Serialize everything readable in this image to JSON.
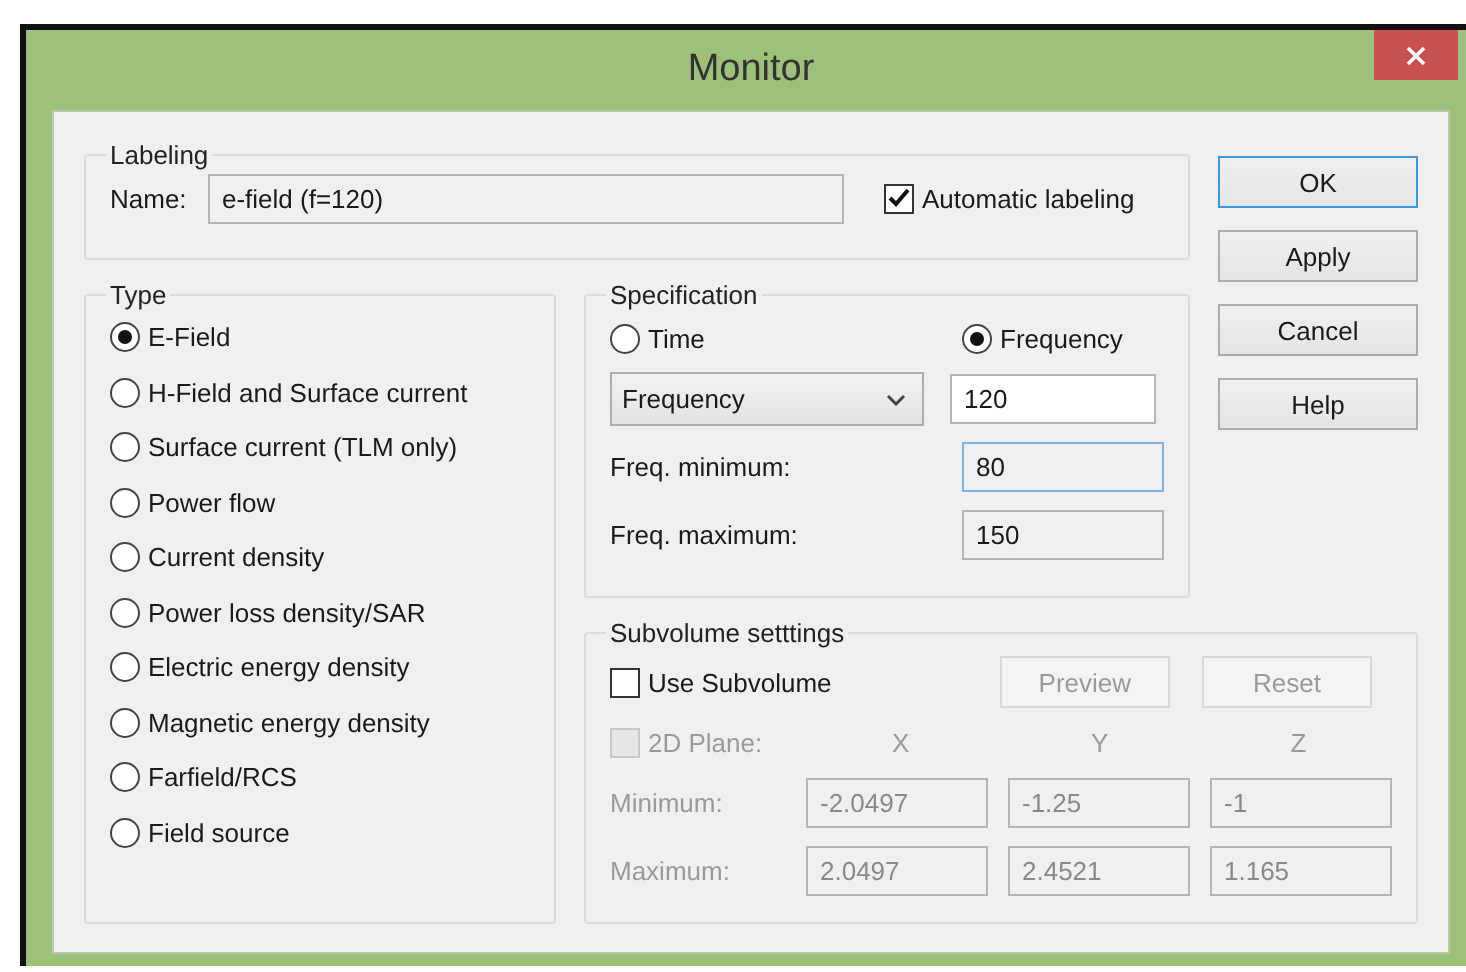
{
  "window": {
    "title": "Monitor"
  },
  "labeling": {
    "legend": "Labeling",
    "name_label": "Name:",
    "name_value": "e-field (f=120)",
    "automatic": {
      "label": "Automatic labeling",
      "checked": true
    }
  },
  "type": {
    "legend": "Type",
    "options": [
      {
        "label": "E-Field",
        "selected": true
      },
      {
        "label": "H-Field and Surface current",
        "selected": false
      },
      {
        "label": "Surface current (TLM only)",
        "selected": false
      },
      {
        "label": "Power flow",
        "selected": false
      },
      {
        "label": "Current density",
        "selected": false
      },
      {
        "label": "Power loss density/SAR",
        "selected": false
      },
      {
        "label": "Electric energy density",
        "selected": false
      },
      {
        "label": "Magnetic energy density",
        "selected": false
      },
      {
        "label": "Farfield/RCS",
        "selected": false
      },
      {
        "label": "Field source",
        "selected": false
      }
    ]
  },
  "specification": {
    "legend": "Specification",
    "modes": [
      {
        "label": "Time",
        "selected": false
      },
      {
        "label": "Frequency",
        "selected": true
      }
    ],
    "dropdown": "Frequency",
    "value": "120",
    "fields": [
      {
        "label": "Freq. minimum:",
        "value": "80",
        "focused": true
      },
      {
        "label": "Freq. maximum:",
        "value": "150",
        "focused": false
      }
    ]
  },
  "subvolume": {
    "legend": "Subvolume setttings",
    "use": {
      "label": "Use Subvolume",
      "checked": false
    },
    "buttons": [
      {
        "label": "Preview",
        "disabled": true
      },
      {
        "label": "Reset",
        "disabled": true
      }
    ],
    "plane": {
      "label": "2D Plane:",
      "checked": false,
      "disabled": true
    },
    "axes": [
      "X",
      "Y",
      "Z"
    ],
    "rows": [
      {
        "label": "Minimum:",
        "values": [
          "-2.0497",
          "-1.25",
          "-1"
        ],
        "disabled": true
      },
      {
        "label": "Maximum:",
        "values": [
          "2.0497",
          "2.4521",
          "1.165"
        ],
        "disabled": true
      }
    ]
  },
  "buttons": [
    {
      "label": "OK",
      "default": true
    },
    {
      "label": "Apply",
      "default": false
    },
    {
      "label": "Cancel",
      "default": false
    },
    {
      "label": "Help",
      "default": false
    }
  ]
}
